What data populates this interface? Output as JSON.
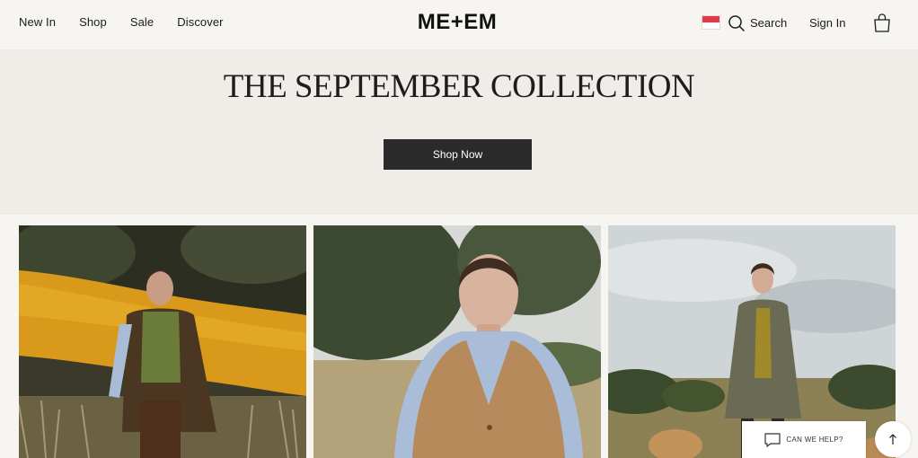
{
  "header": {
    "nav": [
      "New In",
      "Shop",
      "Sale",
      "Discover"
    ],
    "logo": "ME+EM",
    "search_label": "Search",
    "signin_label": "Sign In",
    "flag_icon": "indonesia-flag-icon",
    "bag_icon": "shopping-bag-icon"
  },
  "hero": {
    "title": "THE SEPTEMBER COLLECTION",
    "cta_label": "Shop Now"
  },
  "help": {
    "label": "CAN WE HELP?",
    "icon": "chat-bubble-icon"
  },
  "back_to_top_icon": "arrow-up-icon",
  "colors": {
    "background": "#f7f5f2",
    "hero_background": "#f0ede8",
    "button": "#2b2b2b",
    "flag_red": "#e53945"
  }
}
